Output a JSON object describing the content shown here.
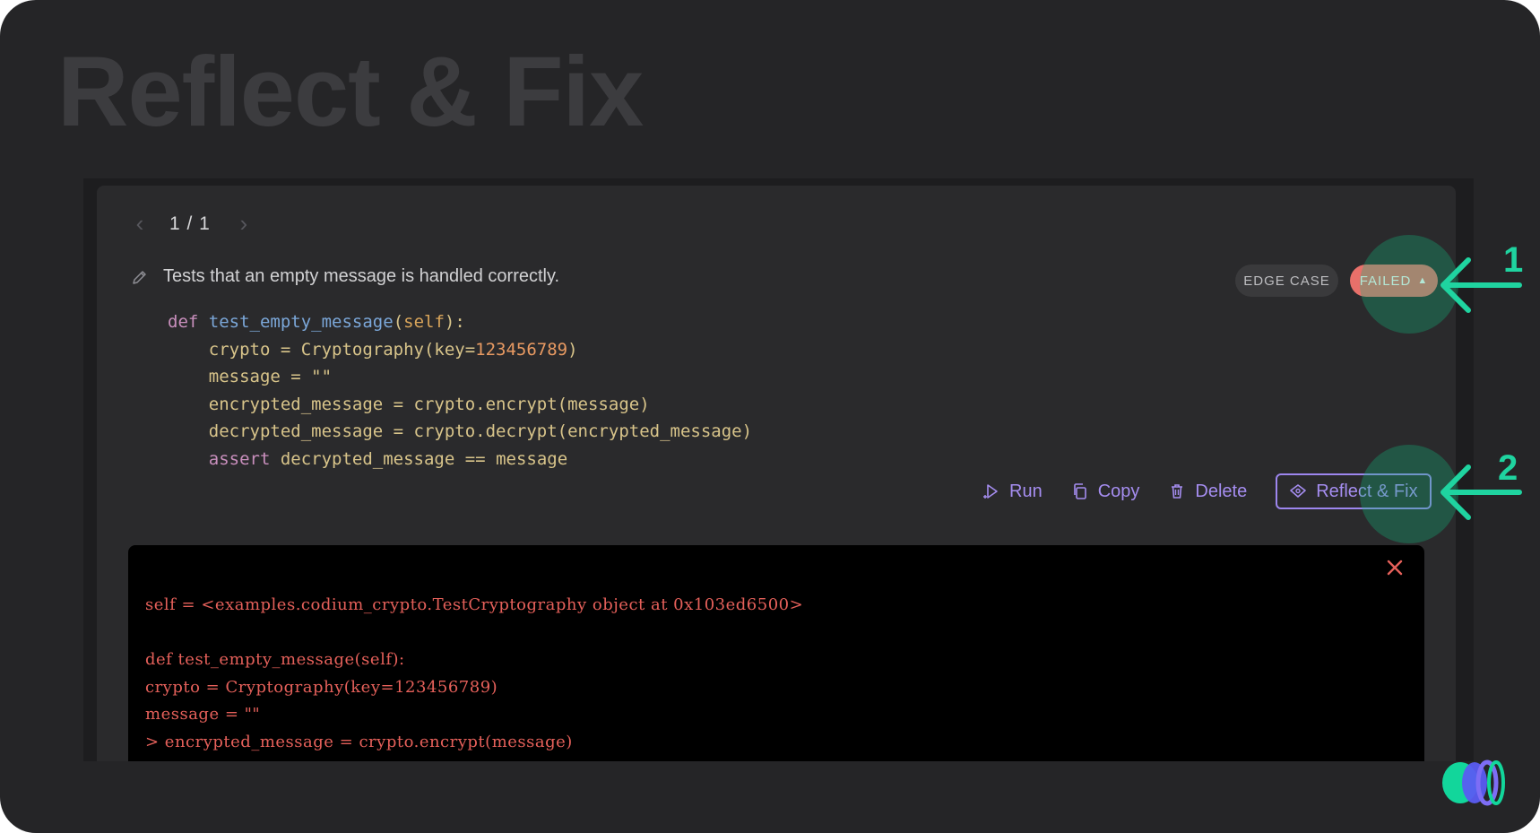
{
  "heading": "Reflect & Fix",
  "pager": {
    "current": "1",
    "separator": "/",
    "total": "1",
    "display": "1 / 1"
  },
  "test": {
    "description": "Tests that an empty message is handled correctly.",
    "badges": {
      "category": "EDGE CASE",
      "status": "FAILED",
      "status_caret": "▲"
    },
    "code": {
      "def_kw": "def",
      "fn_name": "test_empty_message",
      "open_paren": "(",
      "self_kw": "self",
      "close_colon": "):",
      "l2a": "    crypto = Cryptography(key=",
      "l2num": "123456789",
      "l2b": ")",
      "l3a": "    message = ",
      "l3str": "\"\"",
      "l4": "    encrypted_message = crypto.encrypt(message)",
      "l5": "    decrypted_message = crypto.decrypt(encrypted_message)",
      "l6indent": "    ",
      "l6kw": "assert",
      "l6rest": " decrypted_message == message"
    }
  },
  "actions": {
    "run": "Run",
    "copy": "Copy",
    "delete": "Delete",
    "reflect": "Reflect & Fix"
  },
  "console": {
    "lines": [
      "self = <examples.codium_crypto.TestCryptography object at 0x103ed6500>",
      "",
      "def test_empty_message(self):",
      "crypto = Cryptography(key=123456789)",
      "message = \"\"",
      "> encrypted_message = crypto.encrypt(message)"
    ]
  },
  "annotations": {
    "first": "1",
    "second": "2"
  },
  "colors": {
    "background": "#252527",
    "accent_purple": "#a58df0",
    "failed_badge": "#e8706a",
    "annotation_green": "#1fd4a0",
    "console_text": "#e5605a"
  }
}
